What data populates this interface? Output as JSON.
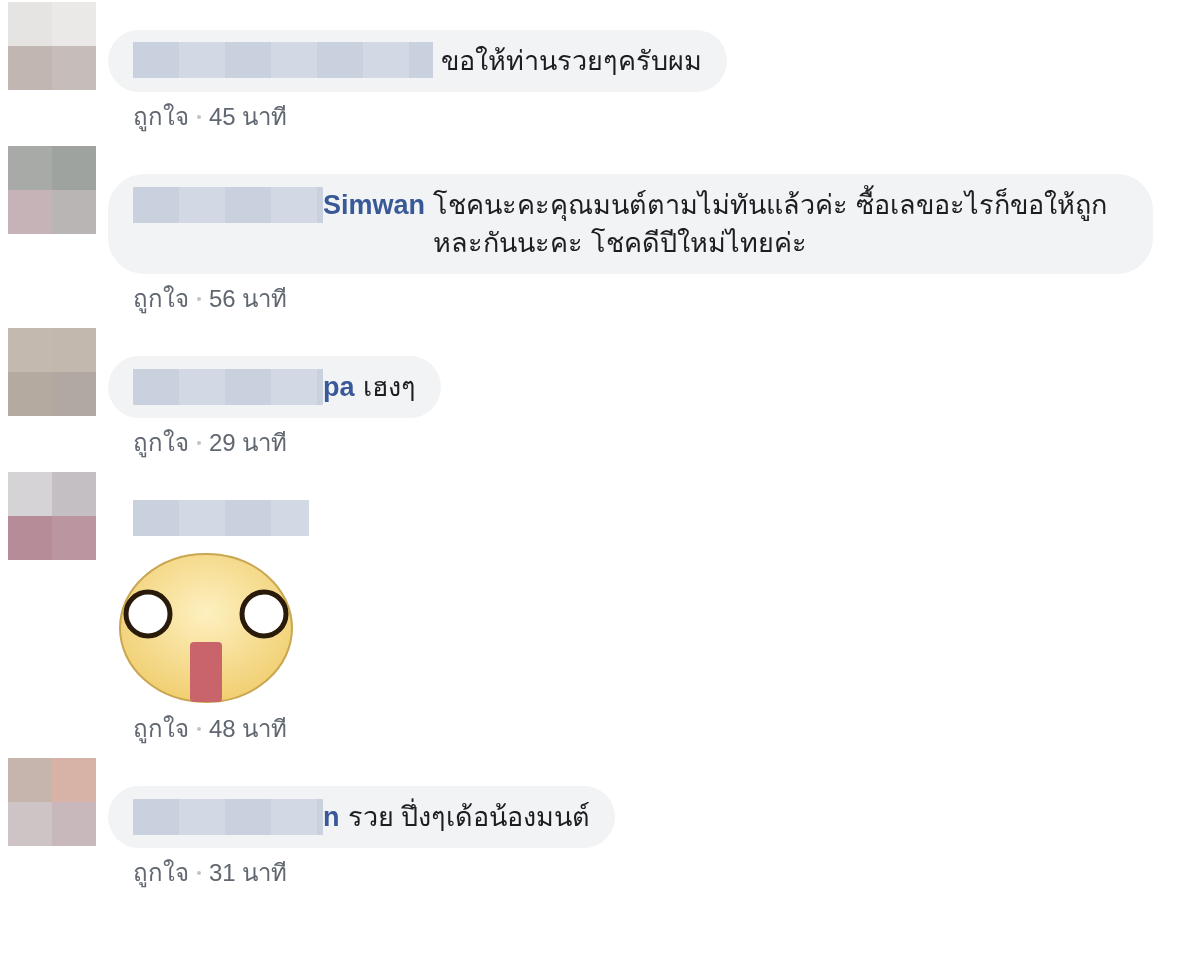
{
  "comments": [
    {
      "text": "ขอให้ท่านรวยๆครับผม",
      "like": "ถูกใจ",
      "time": "45 นาที"
    },
    {
      "name": "Simwan",
      "text": "โชคนะคะคุณมนต์ตามไม่ทันแล้วค่ะ ซื้อเลขอะไรก็ขอให้ถูกหละกันนะคะ โชคดีปีใหม่ไทยค่ะ",
      "like": "ถูกใจ",
      "time": "56 นาที"
    },
    {
      "name": "pa",
      "text": "เฮงๆ",
      "like": "ถูกใจ",
      "time": "29 นาที"
    },
    {
      "kind": "sticker",
      "like": "ถูกใจ",
      "time": "48 นาที"
    },
    {
      "name": "n",
      "text": "รวย ปึ่งๆเด้อน้องมนต์",
      "like": "ถูกใจ",
      "time": "31 นาที"
    }
  ]
}
